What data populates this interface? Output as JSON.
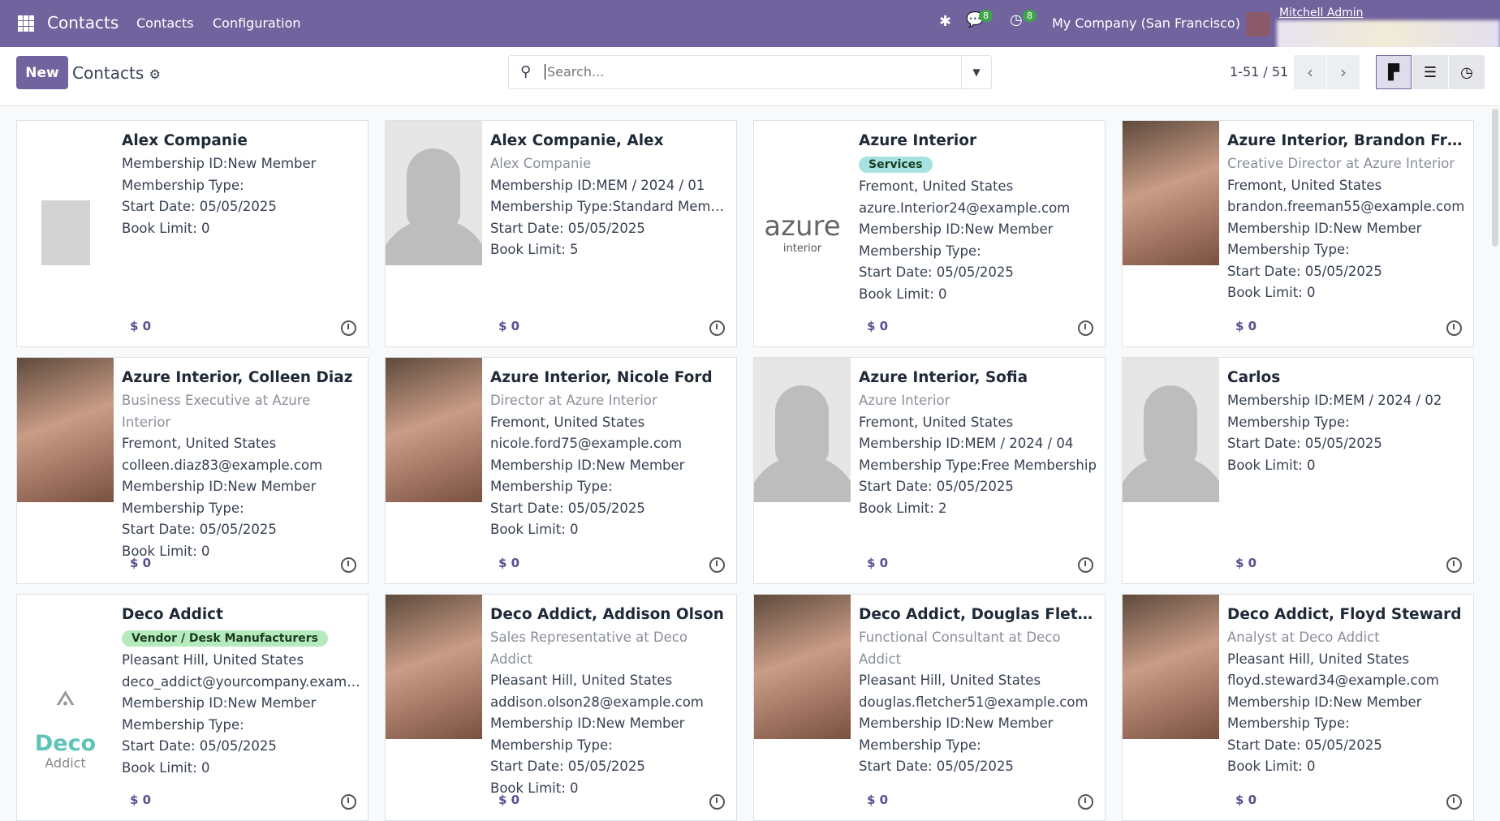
{
  "navbar": {
    "app_title": "Contacts",
    "menu": [
      "Contacts",
      "Configuration"
    ],
    "messages_count": "8",
    "activities_count": "8",
    "company": "My Company (San Francisco)",
    "user": "Mitchell Admin"
  },
  "control": {
    "new_label": "New",
    "breadcrumb": "Contacts",
    "search_placeholder": "Search...",
    "pager": "1-51 / 51"
  },
  "cards": [
    {
      "name": "Alex Companie",
      "lines": [
        "Membership ID:New Member",
        "Membership Type:",
        "Start Date: 05/05/2025",
        "Book Limit: 0"
      ],
      "money": "$ 0",
      "image": "company"
    },
    {
      "name": "Alex Companie, Alex",
      "subtitle": "Alex Companie",
      "lines": [
        "Membership ID:MEM / 2024 / 01",
        "Membership Type:Standard Member",
        "Start Date: 05/05/2025",
        "Book Limit: 5"
      ],
      "money": "$ 0",
      "image": "placeholder"
    },
    {
      "name": "Azure Interior",
      "tag": "Services",
      "tag_color": "#a6e3e0",
      "lines": [
        "Fremont, United States",
        "azure.Interior24@example.com",
        "Membership ID:New Member",
        "Membership Type:",
        "Start Date: 05/05/2025",
        "Book Limit: 0"
      ],
      "money": "$ 0",
      "image": "azure-logo",
      "logo_text": "azure",
      "logo_sub": "interior"
    },
    {
      "name": "Azure Interior, Brandon Freeman",
      "subtitle": "Creative Director at Azure Interior",
      "lines": [
        "Fremont, United States",
        "brandon.freeman55@example.com",
        "Membership ID:New Member",
        "Membership Type:",
        "Start Date: 05/05/2025",
        "Book Limit: 0"
      ],
      "money": "$ 0",
      "image": "photo"
    },
    {
      "name": "Azure Interior, Colleen Diaz",
      "subtitle": "Business Executive at Azure Interior",
      "lines": [
        "Fremont, United States",
        "colleen.diaz83@example.com",
        "Membership ID:New Member",
        "Membership Type:",
        "Start Date: 05/05/2025",
        "Book Limit: 0"
      ],
      "money": "$ 0",
      "image": "photo"
    },
    {
      "name": "Azure Interior, Nicole Ford",
      "subtitle": "Director at Azure Interior",
      "lines": [
        "Fremont, United States",
        "nicole.ford75@example.com",
        "Membership ID:New Member",
        "Membership Type:",
        "Start Date: 05/05/2025",
        "Book Limit: 0"
      ],
      "money": "$ 0",
      "image": "photo"
    },
    {
      "name": "Azure Interior, Sofia",
      "subtitle": "Azure Interior",
      "lines": [
        "Fremont, United States",
        "Membership ID:MEM / 2024 / 04",
        "Membership Type:Free Membership",
        "Start Date: 05/05/2025",
        "Book Limit: 2"
      ],
      "money": "$ 0",
      "image": "placeholder"
    },
    {
      "name": "Carlos",
      "lines": [
        "Membership ID:MEM / 2024 / 02",
        "Membership Type:",
        "Start Date: 05/05/2025",
        "Book Limit: 0"
      ],
      "money": "$ 0",
      "image": "placeholder"
    },
    {
      "name": "Deco Addict",
      "tag": "Vendor / Desk Manufacturers",
      "tag_color": "#b5eabd",
      "lines": [
        "Pleasant Hill, United States",
        "deco_addict@yourcompany.example.com",
        "Membership ID:New Member",
        "Membership Type:",
        "Start Date: 05/05/2025",
        "Book Limit: 0"
      ],
      "money": "$ 0",
      "image": "deco-logo",
      "logo_text": "Deco",
      "logo_sub": "Addict"
    },
    {
      "name": "Deco Addict, Addison Olson",
      "subtitle": "Sales Representative at Deco Addict",
      "lines": [
        "Pleasant Hill, United States",
        "addison.olson28@example.com",
        "Membership ID:New Member",
        "Membership Type:",
        "Start Date: 05/05/2025",
        "Book Limit: 0"
      ],
      "money": "$ 0",
      "image": "photo"
    },
    {
      "name": "Deco Addict, Douglas Fletcher",
      "subtitle": "Functional Consultant at Deco Addict",
      "lines": [
        "Pleasant Hill, United States",
        "douglas.fletcher51@example.com",
        "Membership ID:New Member",
        "Membership Type:",
        "Start Date: 05/05/2025"
      ],
      "money": "$ 0",
      "image": "photo"
    },
    {
      "name": "Deco Addict, Floyd Steward",
      "subtitle": "Analyst at Deco Addict",
      "lines": [
        "Pleasant Hill, United States",
        "floyd.steward34@example.com",
        "Membership ID:New Member",
        "Membership Type:",
        "Start Date: 05/05/2025",
        "Book Limit: 0"
      ],
      "money": "$ 0",
      "image": "photo"
    }
  ]
}
